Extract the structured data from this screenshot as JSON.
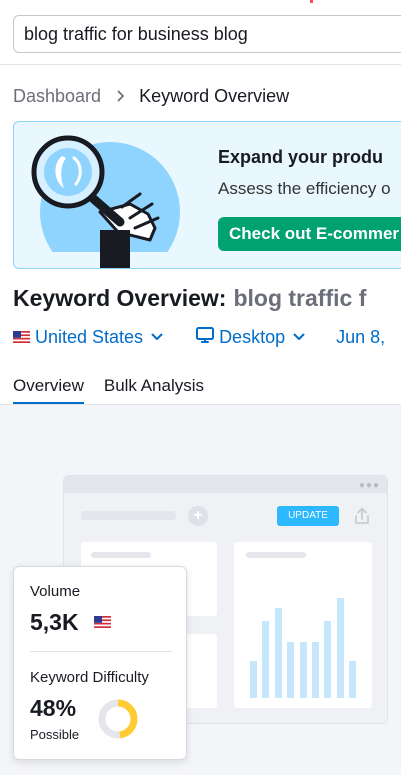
{
  "search": {
    "value": "blog traffic for business blog"
  },
  "breadcrumb": {
    "home": "Dashboard",
    "current": "Keyword Overview"
  },
  "banner": {
    "title": "Expand your produ",
    "text": "Assess the efficiency o",
    "button": "Check out E-commer"
  },
  "header": {
    "title": "Keyword Overview:",
    "keyword": "blog traffic f"
  },
  "filters": {
    "country": "United States",
    "device": "Desktop",
    "date": "Jun 8,"
  },
  "tabs": [
    {
      "label": "Overview",
      "active": true
    },
    {
      "label": "Bulk Analysis",
      "active": false
    }
  ],
  "mock": {
    "update_label": "UPDATE",
    "chart_levels": [
      0.3,
      0.63,
      0.74,
      0.46,
      0.46,
      0.46,
      0.63,
      0.82,
      0.3
    ]
  },
  "metrics": {
    "volume_label": "Volume",
    "volume_value": "5,3K",
    "kd_label": "Keyword Difficulty",
    "kd_value": "48%",
    "kd_note": "Possible",
    "kd_percent": 48
  },
  "colors": {
    "accent": "#006dca",
    "green": "#00a26f",
    "donut": "#ffcc33",
    "banner_bg": "#e9f8ff"
  }
}
